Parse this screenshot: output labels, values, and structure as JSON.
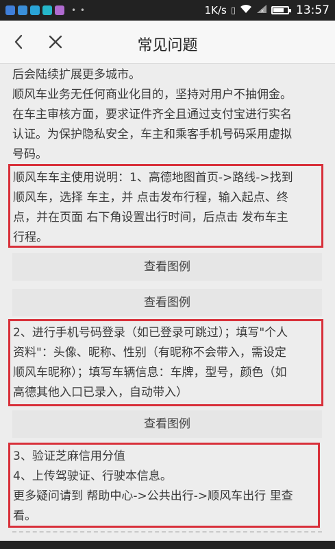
{
  "status_bar": {
    "app_icon_colors": [
      "#3f7fd9",
      "#3a8fd9",
      "#2aa5d8",
      "#25b6c9",
      "#b06bd0"
    ],
    "dots": "• •",
    "speed": "1K/s",
    "time": "13:57",
    "battery_level": 0.8
  },
  "header": {
    "title": "常见问题",
    "back_icon": "chevron-left-icon",
    "close_icon": "close-icon"
  },
  "content": {
    "intro_lines": [
      "后会陆续扩展更多城市。",
      "顺风车业务无任何商业化目的，坚持对用户不抽佣金。",
      "在车主审核方面，要求证件齐全且通过支付宝进行实名",
      "认证。为保护隐私安全，车主和乘客手机号码采用虚拟",
      "号码。"
    ],
    "step1_lines": [
      "顺风车车主使用说明：1、高德地图首页->路线->找到",
      "顺风车，选择 车主，并 点击发布行程，输入起点、终",
      "点，并在页面 右下角设置出行时间，后点击 发布车主",
      "行程。"
    ],
    "example_button_1": "查看图例",
    "example_button_2": "查看图例",
    "step2_lines": [
      "2、进行手机号码登录（如已登录可跳过）；填写\"个人",
      "资料\"：头像、昵称、性别（有昵称不会带入，需设定",
      "顺风车昵称）；填写车辆信息：车牌，型号，颜色（如",
      "高德其他入口已录入，自动带入）"
    ],
    "example_button_3": "查看图例",
    "step3_lines": [
      "3、验证芝麻信用分值",
      "4、上传驾驶证、行驶本信息。",
      "更多疑问请到 帮助中心->公共出行->顺风车出行 里查",
      "看。"
    ],
    "highlight_color": "#d8303a"
  }
}
